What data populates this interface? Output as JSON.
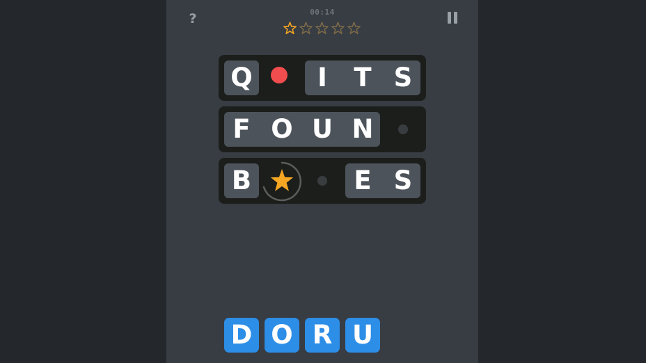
{
  "header": {
    "help_label": "?",
    "timer": "00:14"
  },
  "rating": {
    "filled": 1,
    "total": 5,
    "filled_color": "#f5a623",
    "empty_color": "#7a6a48"
  },
  "rows": [
    {
      "letters": [
        "Q",
        "",
        "I",
        "T",
        "S"
      ],
      "red_marker_slot": 1
    },
    {
      "letters": [
        "F",
        "O",
        "U",
        "N",
        ""
      ]
    },
    {
      "letters": [
        "B",
        "",
        "",
        "E",
        "S"
      ],
      "star_slot": 1
    }
  ],
  "rack": {
    "letters": [
      "D",
      "O",
      "R",
      "U"
    ],
    "color": "#2d8ee7"
  },
  "colors": {
    "background": "#24272c",
    "panel": "#383c43",
    "row": "#1c1e1b",
    "tile": "#4d535b",
    "red_marker": "#f14c4e",
    "star": "#f5a623"
  }
}
